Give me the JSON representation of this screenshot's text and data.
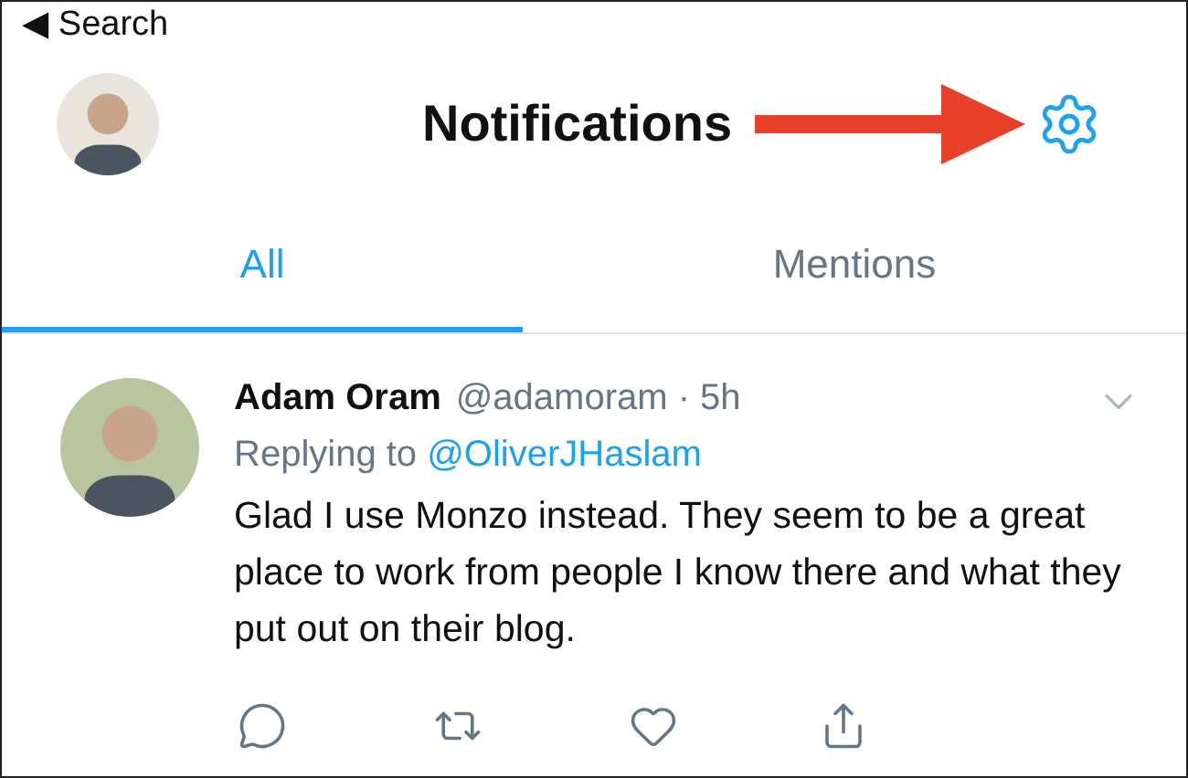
{
  "back_button": {
    "glyph": "◀",
    "label": "Search"
  },
  "header": {
    "title": "Notifications"
  },
  "tabs": [
    {
      "label": "All",
      "selected": true
    },
    {
      "label": "Mentions",
      "selected": false
    }
  ],
  "tweet": {
    "author": "Adam Oram",
    "meta": "@adamoram · 5h",
    "reply": {
      "prefix": "Replying to",
      "mention": "@OliverJHaslam"
    },
    "body": "Glad I use Monzo instead. They seem to be a great place to work from people I know there and what they put out on their blog."
  }
}
